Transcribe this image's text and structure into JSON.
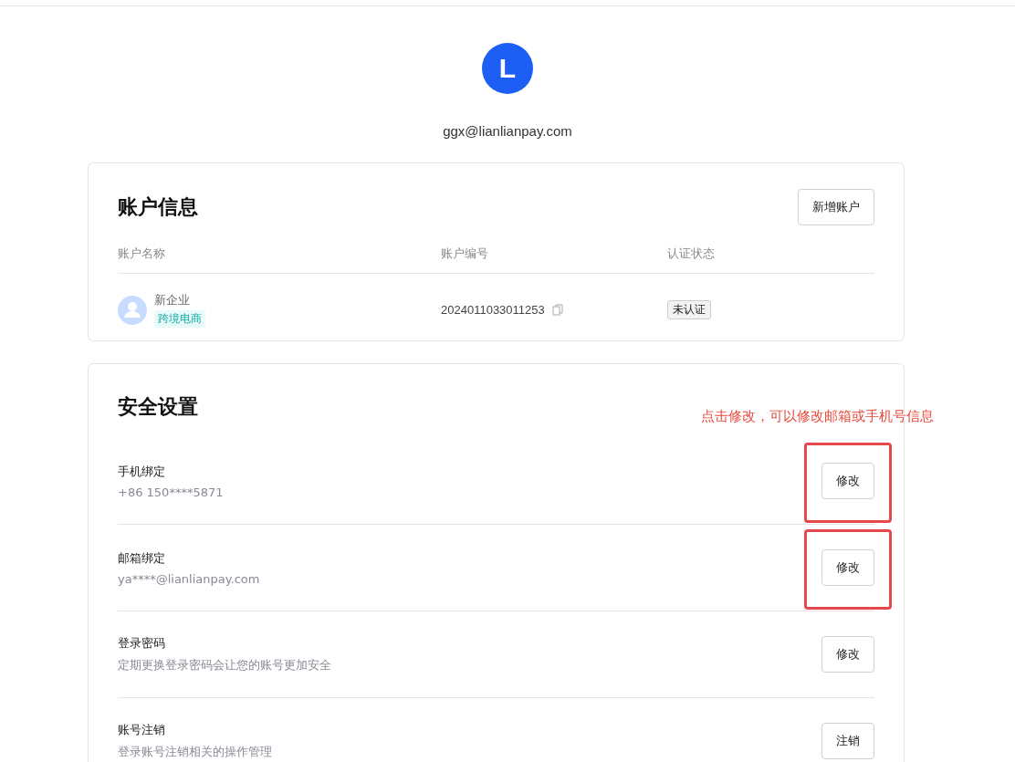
{
  "user": {
    "avatar_letter": "L",
    "email": "ggx@lianlianpay.com"
  },
  "account_info": {
    "title": "账户信息",
    "add_button": "新增账户",
    "columns": [
      "账户名称",
      "账户编号",
      "认证状态"
    ],
    "rows": [
      {
        "name": "新企业",
        "tag": "跨境电商",
        "number": "2024011033011253",
        "status": "未认证"
      }
    ]
  },
  "security": {
    "title": "安全设置",
    "annotation": "点击修改，可以修改邮箱或手机号信息",
    "items": [
      {
        "label": "手机绑定",
        "detail": "+86 150****5871",
        "button": "修改",
        "highlighted": true
      },
      {
        "label": "邮箱绑定",
        "detail": "ya****@lianlianpay.com",
        "button": "修改",
        "highlighted": true
      },
      {
        "label": "登录密码",
        "detail": "定期更换登录密码会让您的账号更加安全",
        "button": "修改",
        "highlighted": false
      },
      {
        "label": "账号注销",
        "detail": "登录账号注销相关的操作管理",
        "button": "注销",
        "highlighted": false
      }
    ]
  }
}
